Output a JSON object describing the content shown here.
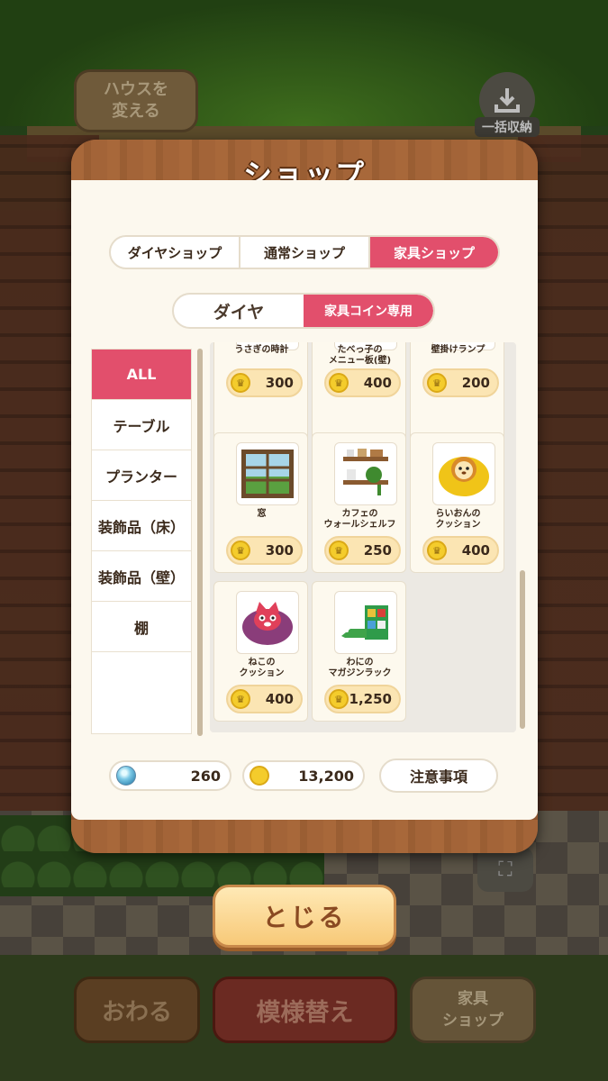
{
  "background": {
    "house_button": "ハウスを\n変える",
    "store_all_button": "一括収納",
    "finish_button": "おわる",
    "pattern_button": "模様替え",
    "furniture_shop_button": "家具\nショップ"
  },
  "modal": {
    "title": "ショップ",
    "tabs": [
      "ダイヤショップ",
      "通常ショップ",
      "家具ショップ"
    ],
    "active_tab": "家具ショップ",
    "subtabs": [
      "ダイヤ",
      "家具コイン専用"
    ],
    "active_subtab": "家具コイン専用",
    "categories": [
      "ALL",
      "テーブル",
      "プランター",
      "装飾品（床）",
      "装飾品（壁）",
      "棚"
    ],
    "active_category": "ALL",
    "items": [
      {
        "name": "うさぎの時計",
        "price": "300",
        "icon": "clock-icon"
      },
      {
        "name": "たべっ子の\nメニュー板(壁)",
        "price": "400",
        "icon": "menu-board-icon"
      },
      {
        "name": "壁掛けランプ",
        "price": "200",
        "icon": "wall-lamp-icon"
      },
      {
        "name": "窓",
        "price": "300",
        "icon": "window-icon"
      },
      {
        "name": "カフェの\nウォールシェルフ",
        "price": "250",
        "icon": "wall-shelf-icon"
      },
      {
        "name": "らいおんの\nクッション",
        "price": "400",
        "icon": "lion-cushion-icon"
      },
      {
        "name": "ねこの\nクッション",
        "price": "400",
        "icon": "cat-cushion-icon"
      },
      {
        "name": "わにの\nマガジンラック",
        "price": "1,250",
        "icon": "crocodile-rack-icon"
      }
    ],
    "currency": {
      "diamonds": "260",
      "coins": "13,200"
    },
    "notice_button": "注意事項"
  },
  "close_button": "とじる",
  "colors": {
    "accent": "#e24f6c",
    "wood": "#a8683a",
    "panel": "#fcf8ee",
    "price_bg": "#fbe5b3"
  }
}
